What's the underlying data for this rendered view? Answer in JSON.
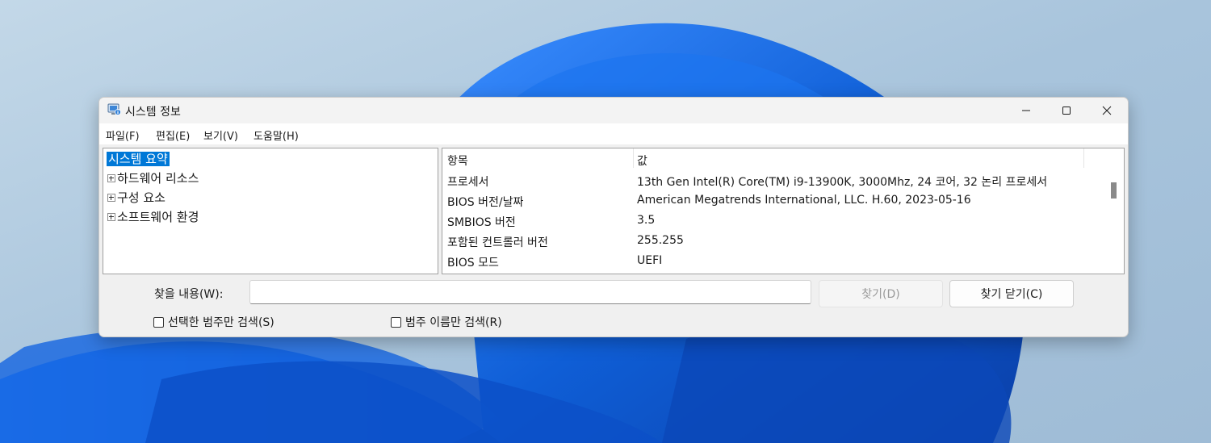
{
  "window": {
    "title": "시스템 정보"
  },
  "menu": {
    "items": [
      "파일(F)",
      "편집(E)",
      "보기(V)",
      "도움말(H)"
    ]
  },
  "tree": {
    "items": [
      {
        "label": "시스템 요약",
        "selected": true,
        "expandable": false
      },
      {
        "label": "하드웨어 리소스",
        "selected": false,
        "expandable": true
      },
      {
        "label": "구성 요소",
        "selected": false,
        "expandable": true
      },
      {
        "label": "소프트웨어 환경",
        "selected": false,
        "expandable": true
      }
    ]
  },
  "details": {
    "headers": {
      "item": "항목",
      "value": "값"
    },
    "rows": [
      {
        "item": "프로세서",
        "value": "13th Gen Intel(R) Core(TM) i9-13900K, 3000Mhz, 24 코어, 32 논리 프로세서"
      },
      {
        "item": "BIOS 버전/날짜",
        "value": "American Megatrends International, LLC. H.60, 2023-05-16"
      },
      {
        "item": "SMBIOS 버전",
        "value": "3.5"
      },
      {
        "item": "포함된 컨트롤러 버전",
        "value": "255.255"
      },
      {
        "item": "BIOS 모드",
        "value": "UEFI"
      }
    ]
  },
  "find": {
    "label": "찾을 내용(W):",
    "value": "",
    "find_button": "찾기(D)",
    "close_button": "찾기 닫기(C)",
    "option_selected_category": "선택한 범주만 검색(S)",
    "option_category_names": "범주 이름만 검색(R)"
  },
  "icons": {
    "app": "system-info-icon",
    "minimize": "minimize-icon",
    "maximize": "maximize-icon",
    "close": "close-icon"
  },
  "colors": {
    "selection": "#0078d7",
    "accent_wallpaper": "#1b6fe0"
  }
}
